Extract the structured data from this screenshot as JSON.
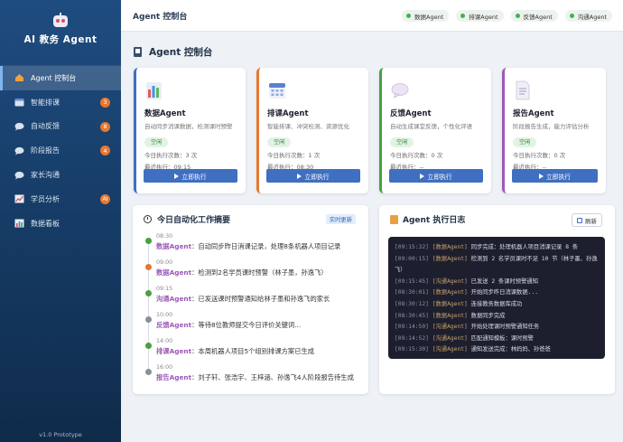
{
  "app": {
    "title": "AI 教务 Agent",
    "version": "v1.0 Prototype"
  },
  "sidebar": {
    "items": [
      {
        "label": "Agent 控制台",
        "icon": "home-icon",
        "badge": "",
        "active": true
      },
      {
        "label": "智能排课",
        "icon": "calendar-icon",
        "badge": "3"
      },
      {
        "label": "自动反馈",
        "icon": "chat-icon",
        "badge": "8"
      },
      {
        "label": "阶段报告",
        "icon": "chat-icon",
        "badge": "4"
      },
      {
        "label": "家长沟通",
        "icon": "chat-icon",
        "badge": ""
      },
      {
        "label": "学员分析",
        "icon": "chart-icon",
        "badge": "AI"
      },
      {
        "label": "数据看板",
        "icon": "bar-chart-icon",
        "badge": ""
      }
    ]
  },
  "topbar": {
    "title": "Agent 控制台",
    "status": [
      "数据Agent",
      "排课Agent",
      "反馈Agent",
      "沟通Agent"
    ]
  },
  "section": {
    "title": "Agent 控制台"
  },
  "cards": [
    {
      "name": "数据Agent",
      "desc": "自动同步消课数据，检测课时预警",
      "status": "空闲",
      "runs": "今日执行次数：3 次",
      "last": "最近执行：09:15",
      "button": "立即执行",
      "color": "#3f6fc0",
      "icon": "data-chart-icon"
    },
    {
      "name": "排课Agent",
      "desc": "智能排课、冲突检测、资源优化",
      "status": "空闲",
      "runs": "今日执行次数：1 次",
      "last": "最近执行：08:30",
      "button": "立即执行",
      "color": "#e8772e",
      "icon": "calendar-icon"
    },
    {
      "name": "反馈Agent",
      "desc": "自动生成课堂反馈，个性化评语",
      "status": "空闲",
      "runs": "今日执行次数：0 次",
      "last": "最近执行：--",
      "button": "立即执行",
      "color": "#4aa043",
      "icon": "speech-bubble-icon"
    },
    {
      "name": "报告Agent",
      "desc": "阶段报告生成，能力评估分析",
      "status": "空闲",
      "runs": "今日执行次数：0 次",
      "last": "最近执行：--",
      "button": "立即执行",
      "color": "#9b59b6",
      "icon": "document-icon"
    }
  ],
  "summary": {
    "title": "今日自动化工作摘要",
    "badge": "实时更新",
    "items": [
      {
        "time": "08:30",
        "agent": "数据Agent：",
        "text": "自动同步昨日消课记录，处理8条机器人项目记录",
        "color": "#4aa043",
        "agent_color": "#9b59b6"
      },
      {
        "time": "09:00",
        "agent": "数据Agent：",
        "text": "检测到2名学员课时预警（林子墨，孙逸飞）",
        "color": "#e8772e",
        "agent_color": "#9b59b6"
      },
      {
        "time": "09:15",
        "agent": "沟通Agent：",
        "text": "已发送课时预警通知给林子墨和孙逸飞的家长",
        "color": "#4aa043",
        "agent_color": "#9b59b6"
      },
      {
        "time": "10:00",
        "agent": "反馈Agent：",
        "text": "等待8位教师提交今日评价关键词...",
        "color": "#8a8f99",
        "agent_color": "#9b59b6"
      },
      {
        "time": "14:00",
        "agent": "排课Agent：",
        "text": "本周机器人项目5个组别排课方案已生成",
        "color": "#4aa043",
        "agent_color": "#9b59b6"
      },
      {
        "time": "16:00",
        "agent": "报告Agent：",
        "text": "刘子轩、张浩宇、王梓涵、孙逸飞4人阶段报告待生成",
        "color": "#8a8f99",
        "agent_color": "#9b59b6"
      }
    ]
  },
  "log": {
    "title": "Agent 执行日志",
    "refresh": "刷新",
    "lines": [
      {
        "time": "[09:15:32]",
        "agent": "[数据Agent]",
        "msg": "同步完成：处理机器人项目消课记录 8 条",
        "wrap": false
      },
      {
        "time": "[09:00:15]",
        "agent": "[数据Agent]",
        "msg": "检测到 2 名学员课时不足 10 节（林子墨、孙逸飞）",
        "wrap": true
      },
      {
        "time": "[09:15:45]",
        "agent": "[沟通Agent]",
        "msg": "已发送 2 条课时预警通知",
        "wrap": false
      },
      {
        "time": "[08:30:01]",
        "agent": "[数据Agent]",
        "msg": "开始同步昨日消课数据...",
        "wrap": false
      },
      {
        "time": "[08:30:12]",
        "agent": "[数据Agent]",
        "msg": "连接教务数据库成功",
        "wrap": false
      },
      {
        "time": "[08:30:45]",
        "agent": "[数据Agent]",
        "msg": "数据同步完成",
        "wrap": false
      },
      {
        "time": "[09:14:50]",
        "agent": "[沟通Agent]",
        "msg": "开始处理课时预警通知任务",
        "wrap": false
      },
      {
        "time": "[09:14:52]",
        "agent": "[沟通Agent]",
        "msg": "匹配通知模板：课时预警",
        "wrap": false
      },
      {
        "time": "[09:15:30]",
        "agent": "[沟通Agent]",
        "msg": "通知发送完成：林妈妈、孙爸爸",
        "wrap": false
      }
    ]
  }
}
